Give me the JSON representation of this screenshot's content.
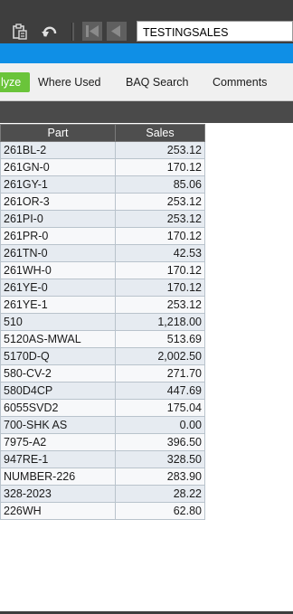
{
  "toolbar": {
    "icons": {
      "clipboard": "clipboard-icon",
      "undo": "undo-icon",
      "first": "first-record-icon",
      "previous": "previous-record-icon"
    },
    "record_id": "TESTINGSALES"
  },
  "tabs": [
    {
      "label": "lyze",
      "active": true
    },
    {
      "label": "Where Used",
      "active": false
    },
    {
      "label": "BAQ Search",
      "active": false
    },
    {
      "label": "Comments",
      "active": false
    }
  ],
  "colors": {
    "toolbar": "#3e3e3e",
    "accent_blue": "#0f8fe6",
    "active_tab": "#6ac43a",
    "grid_header": "#4e4e4e"
  },
  "grid": {
    "columns": [
      "Part",
      "Sales"
    ],
    "rows": [
      {
        "part": "261BL-2",
        "sales": "253.12"
      },
      {
        "part": "261GN-0",
        "sales": "170.12"
      },
      {
        "part": "261GY-1",
        "sales": "85.06"
      },
      {
        "part": "261OR-3",
        "sales": "253.12"
      },
      {
        "part": "261PI-0",
        "sales": "253.12"
      },
      {
        "part": "261PR-0",
        "sales": "170.12"
      },
      {
        "part": "261TN-0",
        "sales": "42.53"
      },
      {
        "part": "261WH-0",
        "sales": "170.12"
      },
      {
        "part": "261YE-0",
        "sales": "170.12"
      },
      {
        "part": "261YE-1",
        "sales": "253.12"
      },
      {
        "part": "510",
        "sales": "1,218.00"
      },
      {
        "part": "5120AS-MWAL",
        "sales": "513.69"
      },
      {
        "part": "5170D-Q",
        "sales": "2,002.50"
      },
      {
        "part": "580-CV-2",
        "sales": "271.70"
      },
      {
        "part": "580D4CP",
        "sales": "447.69"
      },
      {
        "part": "6055SVD2",
        "sales": "175.04"
      },
      {
        "part": "700-SHK AS",
        "sales": "0.00"
      },
      {
        "part": "7975-A2",
        "sales": "396.50"
      },
      {
        "part": "947RE-1",
        "sales": "328.50"
      },
      {
        "part": "NUMBER-226",
        "sales": "283.90"
      },
      {
        "part": "328-2023",
        "sales": "28.22"
      },
      {
        "part": "226WH",
        "sales": "62.80"
      }
    ]
  }
}
